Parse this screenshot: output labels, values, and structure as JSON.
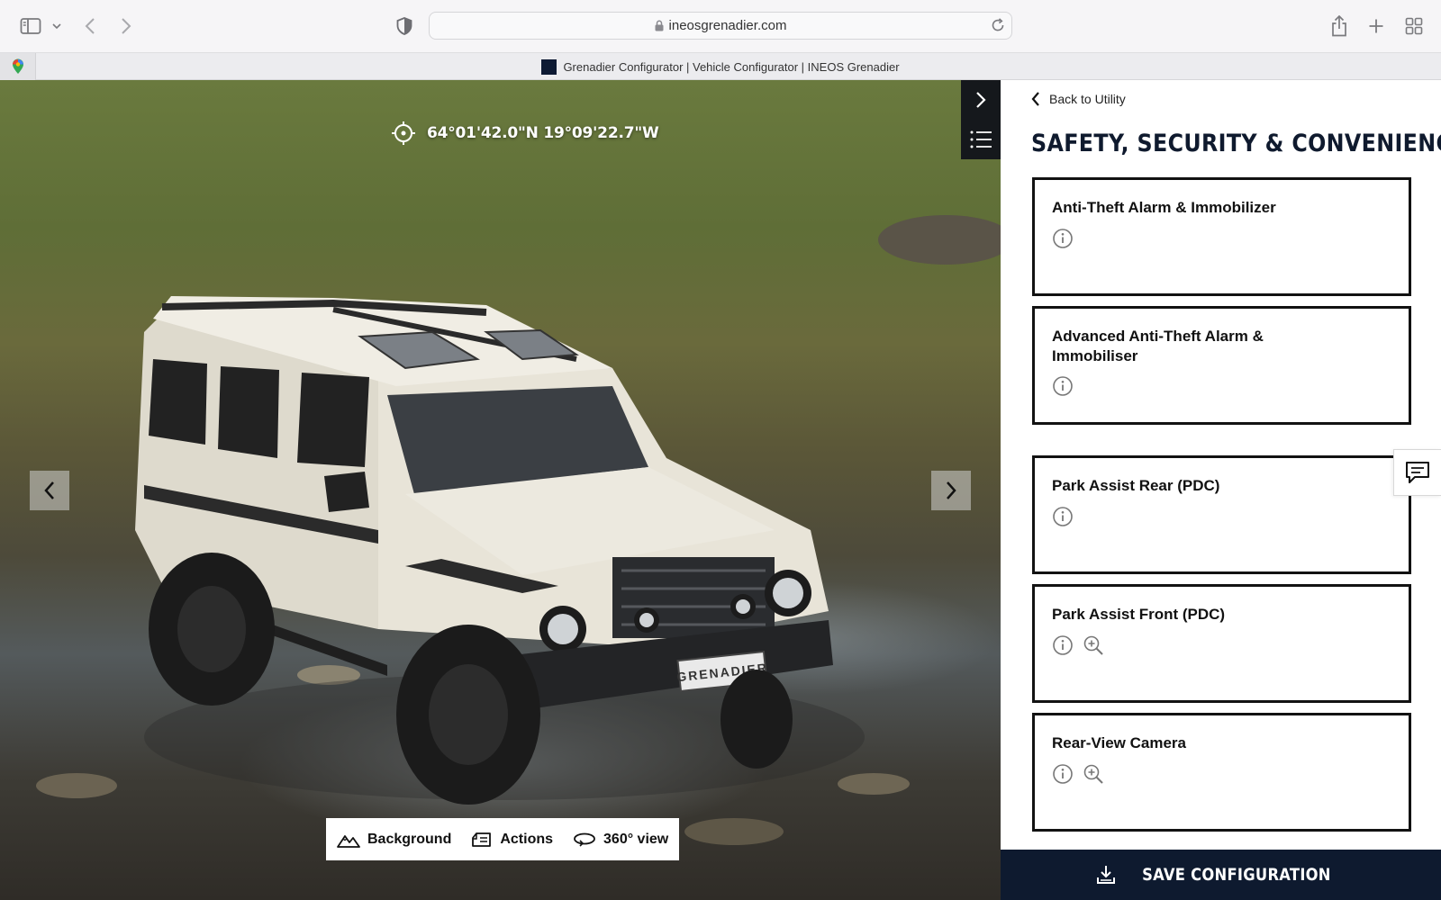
{
  "browser": {
    "url": "ineosgrenadier.com",
    "tab_title": "Grenadier Configurator | Vehicle Configurator | INEOS Grenadier"
  },
  "viewer": {
    "coordinates": "64°01'42.0\"N 19°09'22.7\"W",
    "plate": "GRENADIER",
    "toolbar": [
      {
        "label": "Background",
        "icon": "mountain-icon"
      },
      {
        "label": "Actions",
        "icon": "actions-icon"
      },
      {
        "label": "360° view",
        "icon": "rotate-360-icon"
      }
    ]
  },
  "panel": {
    "back_label": "Back to Utility",
    "section_title": "SAFETY, SECURITY & CONVENIENCE",
    "options": [
      {
        "title": "Anti-Theft Alarm & Immobilizer",
        "icons": [
          "info-icon"
        ]
      },
      {
        "title": "Advanced Anti-Theft Alarm & Immobiliser",
        "icons": [
          "info-icon"
        ]
      },
      {
        "title": "Park Assist Rear (PDC)",
        "icons": [
          "info-icon"
        ]
      },
      {
        "title": "Park Assist Front (PDC)",
        "icons": [
          "info-icon",
          "zoom-in-icon"
        ]
      },
      {
        "title": "Rear-View Camera",
        "icons": [
          "info-icon",
          "zoom-in-icon"
        ]
      }
    ],
    "save_label": "SAVE CONFIGURATION"
  },
  "colors": {
    "navy": "#0e1a2f",
    "card_border": "#121212",
    "vehicle_body": "#e6e2d6"
  }
}
